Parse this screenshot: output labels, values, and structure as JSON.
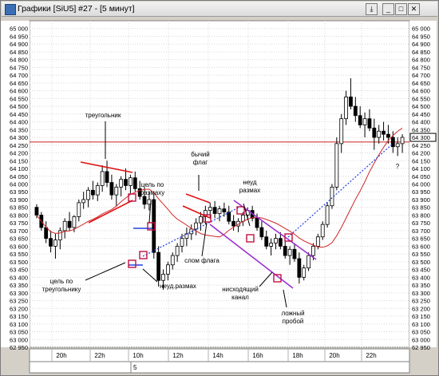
{
  "window": {
    "title": "Графики [SiU5] #27 - [5 минут]",
    "buttons": [
      "⤓",
      "_",
      "□",
      "✕"
    ]
  },
  "chart_data": {
    "type": "candlestick",
    "symbol": "SiU5",
    "timeframe": "5 минут",
    "ylim": [
      62950,
      65050
    ],
    "y_ticks": [
      65000,
      64950,
      64900,
      64850,
      64800,
      64750,
      64700,
      64650,
      64600,
      64550,
      64500,
      64450,
      64400,
      64350,
      64300,
      64250,
      64200,
      64150,
      64100,
      64050,
      64000,
      63950,
      63900,
      63850,
      63800,
      63750,
      63700,
      63650,
      63600,
      63550,
      63500,
      63450,
      63400,
      63350,
      63300,
      63250,
      63200,
      63150,
      63100,
      63050,
      63000,
      62950
    ],
    "y_tick_labels": [
      "65 000",
      "64 950",
      "64 900",
      "64 850",
      "64 800",
      "64 750",
      "64 700",
      "64 650",
      "64 600",
      "64 550",
      "64 500",
      "64 450",
      "64 400",
      "64 350",
      "64 300",
      "64 250",
      "64 200",
      "64 150",
      "64 100",
      "64 050",
      "64 000",
      "63 950",
      "63 900",
      "63 850",
      "63 800",
      "63 750",
      "63 700",
      "63 650",
      "63 600",
      "63 550",
      "63 500",
      "63 450",
      "63 400",
      "63 350",
      "63 300",
      "63 250",
      "63 200",
      "63 150",
      "63 100",
      "63 050",
      "63 000",
      "62 950"
    ],
    "x_tick_labels": [
      "20h",
      "22h",
      "10h",
      "12h",
      "14h",
      "16h",
      "18h",
      "20h",
      "22h"
    ],
    "date_label": "5",
    "horizontal_level": 64270,
    "last_price_label": "64 300",
    "candles": [
      [
        63850,
        63870,
        63780,
        63800
      ],
      [
        63800,
        63820,
        63700,
        63720
      ],
      [
        63720,
        63760,
        63620,
        63650
      ],
      [
        63650,
        63700,
        63560,
        63600
      ],
      [
        63600,
        63680,
        63520,
        63640
      ],
      [
        63640,
        63720,
        63580,
        63700
      ],
      [
        63700,
        63780,
        63650,
        63760
      ],
      [
        63760,
        63820,
        63700,
        63720
      ],
      [
        63720,
        63800,
        63690,
        63790
      ],
      [
        63790,
        63900,
        63760,
        63880
      ],
      [
        63880,
        63950,
        63840,
        63900
      ],
      [
        63900,
        63980,
        63850,
        63960
      ],
      [
        63960,
        64020,
        63900,
        63930
      ],
      [
        63930,
        64010,
        63890,
        63990
      ],
      [
        63990,
        64120,
        63950,
        64080
      ],
      [
        64080,
        64150,
        63980,
        64010
      ],
      [
        64010,
        64060,
        63900,
        63930
      ],
      [
        63930,
        64000,
        63860,
        63980
      ],
      [
        63980,
        64050,
        63920,
        64030
      ],
      [
        64030,
        64100,
        63960,
        63990
      ],
      [
        63990,
        64060,
        63940,
        64040
      ],
      [
        64040,
        64080,
        63950,
        63970
      ],
      [
        63970,
        64020,
        63900,
        63920
      ],
      [
        63920,
        63980,
        63840,
        63870
      ],
      [
        63870,
        63950,
        63830,
        63900
      ],
      [
        63900,
        63940,
        63520,
        63560
      ],
      [
        63560,
        63600,
        63340,
        63380
      ],
      [
        63380,
        63450,
        63320,
        63420
      ],
      [
        63420,
        63500,
        63380,
        63480
      ],
      [
        63480,
        63560,
        63450,
        63540
      ],
      [
        63540,
        63620,
        63500,
        63600
      ],
      [
        63600,
        63680,
        63560,
        63650
      ],
      [
        63650,
        63720,
        63600,
        63680
      ],
      [
        63680,
        63740,
        63640,
        63710
      ],
      [
        63710,
        63780,
        63670,
        63750
      ],
      [
        63750,
        63820,
        63700,
        63790
      ],
      [
        63790,
        63860,
        63740,
        63830
      ],
      [
        63830,
        63880,
        63780,
        63850
      ],
      [
        63850,
        63890,
        63780,
        63810
      ],
      [
        63810,
        63860,
        63760,
        63840
      ],
      [
        63840,
        63880,
        63790,
        63820
      ],
      [
        63820,
        63860,
        63740,
        63760
      ],
      [
        63760,
        63800,
        63700,
        63730
      ],
      [
        63730,
        63780,
        63690,
        63760
      ],
      [
        63760,
        63820,
        63730,
        63800
      ],
      [
        63800,
        63850,
        63770,
        63830
      ],
      [
        63830,
        63860,
        63760,
        63780
      ],
      [
        63780,
        63810,
        63700,
        63720
      ],
      [
        63720,
        63760,
        63640,
        63660
      ],
      [
        63660,
        63700,
        63580,
        63600
      ],
      [
        63600,
        63650,
        63540,
        63620
      ],
      [
        63620,
        63680,
        63580,
        63650
      ],
      [
        63650,
        63690,
        63580,
        63600
      ],
      [
        63600,
        63640,
        63520,
        63540
      ],
      [
        63540,
        63600,
        63480,
        63580
      ],
      [
        63580,
        63620,
        63500,
        63520
      ],
      [
        63520,
        63560,
        63360,
        63400
      ],
      [
        63400,
        63480,
        63380,
        63460
      ],
      [
        63460,
        63560,
        63440,
        63540
      ],
      [
        63540,
        63620,
        63510,
        63600
      ],
      [
        63600,
        63680,
        63580,
        63660
      ],
      [
        63660,
        63760,
        63640,
        63740
      ],
      [
        63740,
        63880,
        63720,
        63860
      ],
      [
        63860,
        64000,
        63840,
        63980
      ],
      [
        63980,
        64300,
        63960,
        64260
      ],
      [
        64260,
        64450,
        64200,
        64420
      ],
      [
        64420,
        64600,
        64380,
        64560
      ],
      [
        64560,
        64680,
        64480,
        64500
      ],
      [
        64500,
        64560,
        64400,
        64440
      ],
      [
        64440,
        64500,
        64360,
        64380
      ],
      [
        64380,
        64460,
        64300,
        64420
      ],
      [
        64420,
        64480,
        64340,
        64360
      ],
      [
        64360,
        64420,
        64220,
        64300
      ],
      [
        64300,
        64380,
        64260,
        64340
      ],
      [
        64340,
        64400,
        64280,
        64320
      ],
      [
        64320,
        64380,
        64260,
        64300
      ],
      [
        64300,
        64340,
        64200,
        64240
      ],
      [
        64240,
        64300,
        64180,
        64260
      ],
      [
        64260,
        64320,
        64200,
        64300
      ]
    ],
    "indicator_line": "moving-average",
    "annotations": [
      {
        "text": "треугольник"
      },
      {
        "text": "цель по\nразмаху"
      },
      {
        "text": "бычий\nфлаг"
      },
      {
        "text": "неуд\nразмах"
      },
      {
        "text": "слом флага"
      },
      {
        "text": "цель по\nтреугольнику"
      },
      {
        "text": "неуд.размах"
      },
      {
        "text": "нисходящий\nканал"
      },
      {
        "text": "ложный\nпробой"
      },
      {
        "text": "?"
      }
    ]
  }
}
